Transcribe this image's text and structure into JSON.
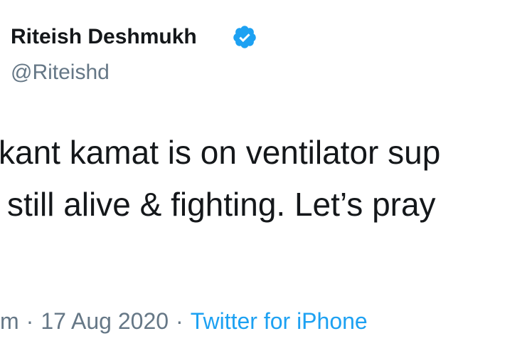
{
  "tweet": {
    "author_name": "Riteish Deshmukh",
    "handle": "@Riteishd",
    "verified_icon": "verified-badge-icon",
    "text_lines": [
      "kant kamat is on ventilator sup",
      "still alive & fighting. Let’s pray"
    ],
    "time_fragment": "m",
    "separator": "·",
    "date": "17 Aug 2020",
    "source": "Twitter for iPhone"
  },
  "colors": {
    "text": "#14171a",
    "secondary": "#657786",
    "accent": "#1da1f2",
    "background": "#ffffff"
  }
}
